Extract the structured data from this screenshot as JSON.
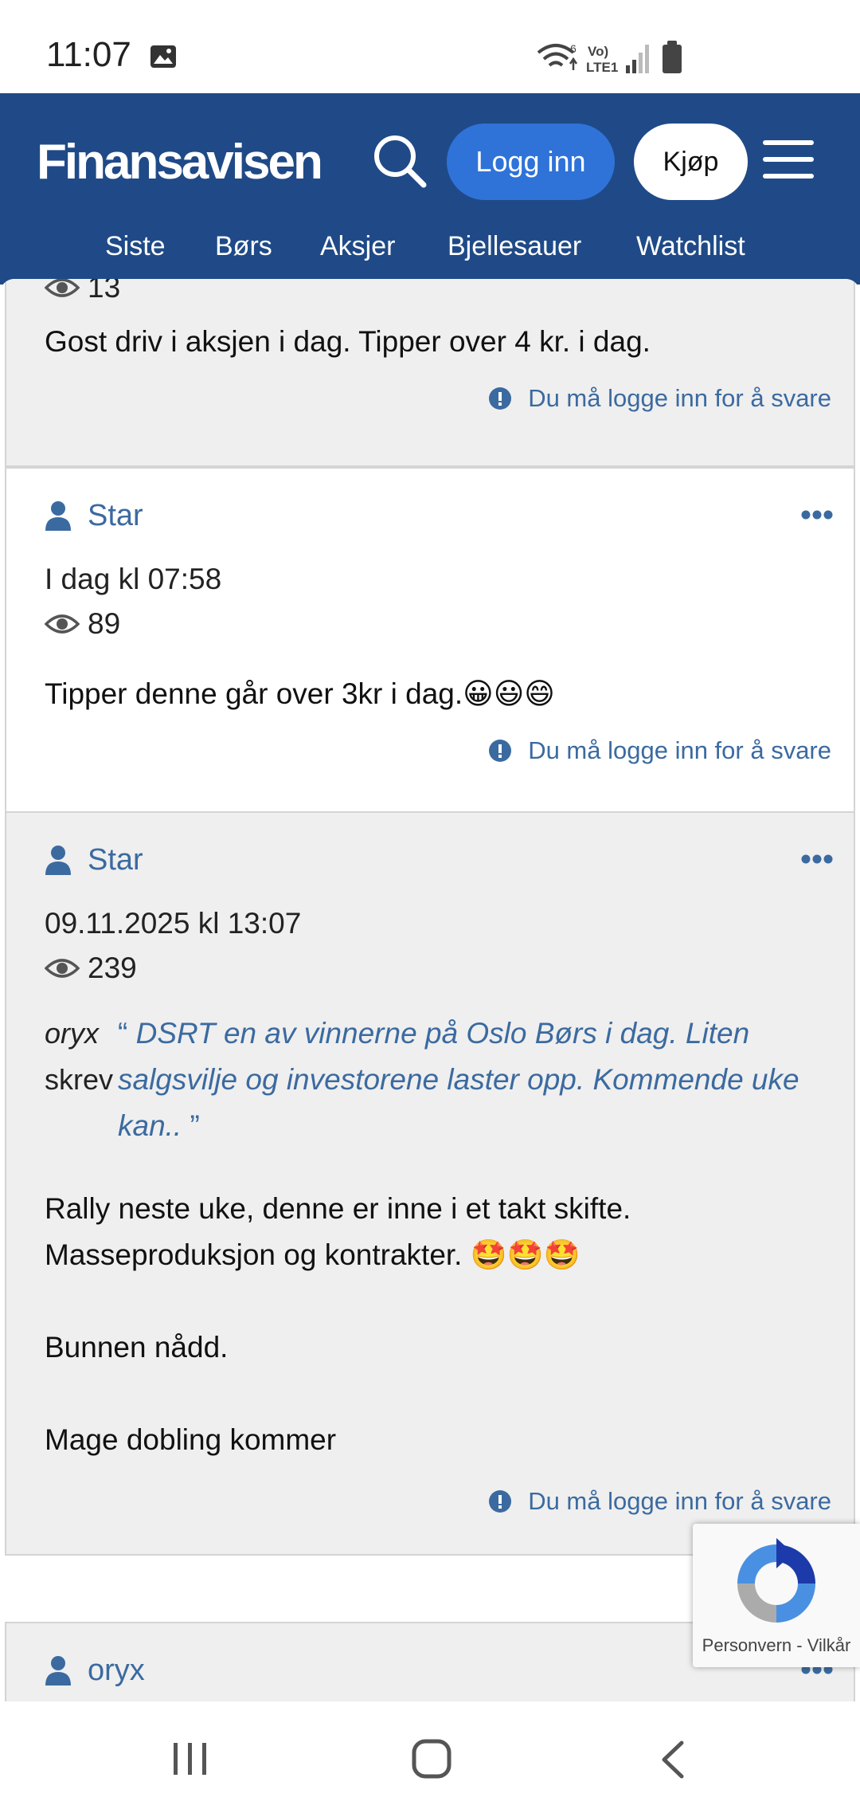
{
  "status_bar": {
    "time": "11:07",
    "icons": [
      "image-icon",
      "wifi-icon",
      "volte-icon",
      "signal-icon",
      "battery-icon"
    ],
    "network_label": "Vo) LTE1"
  },
  "header": {
    "logo": "Finansavisen",
    "login_label": "Logg inn",
    "buy_label": "Kjøp",
    "nav": [
      "Siste",
      "Børs",
      "Aksjer",
      "Bjellesauer",
      "Watchlist"
    ],
    "background_color": "#1f4a87",
    "login_color": "#2f73d9"
  },
  "posts": [
    {
      "views": "13",
      "text": "Gost driv i aksjen i dag. Tipper over 4 kr. i dag.",
      "reply_notice": "Du må logge inn for å svare"
    },
    {
      "author": "Star",
      "date": "I dag kl 07:58",
      "views": "89",
      "text": "Tipper denne går over 3kr i dag.😀😃😄",
      "reply_notice": "Du må logge inn for å svare"
    },
    {
      "author": "Star",
      "date": "09.11.2025 kl 13:07",
      "views": "239",
      "quote_author": "oryx",
      "quote_verb": "skrev",
      "quote_text": "DSRT en av vinnerne på Oslo Børs i dag. Liten salgsvilje og investorene laster opp. Kommende uke kan..",
      "text_lines": [
        "Rally neste uke, denne er inne i et takt skifte.",
        "Masseproduksjon og kontrakter. 🤩🤩🤩",
        "Bunnen nådd.",
        "Mage dobling kommer"
      ],
      "reply_notice": "Du må logge inn for å svare"
    },
    {
      "author": "oryx"
    }
  ],
  "recaptcha": {
    "label": "Personvern - Vilkår"
  }
}
